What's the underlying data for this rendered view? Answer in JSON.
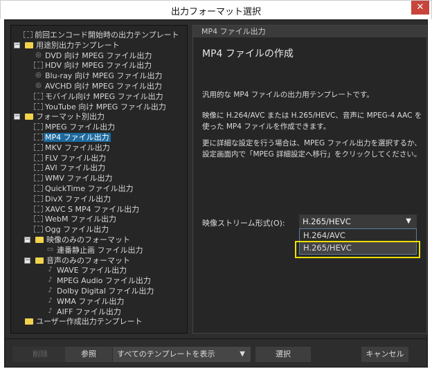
{
  "window": {
    "title": "出力フォーマット選択",
    "close": "✕"
  },
  "tree": [
    {
      "label": "前回エンコード開始時の出力テンプレート",
      "level": 0,
      "icon": "film"
    },
    {
      "label": "用途別出力テンプレート",
      "level": 0,
      "icon": "folder",
      "expanded": true
    },
    {
      "label": "DVD 向け MPEG ファイル出力",
      "level": 1,
      "icon": "disc"
    },
    {
      "label": "HDV 向け MPEG ファイル出力",
      "level": 1,
      "icon": "film"
    },
    {
      "label": "Blu-ray 向け MPEG ファイル出力",
      "level": 1,
      "icon": "disc"
    },
    {
      "label": "AVCHD 向け MPEG ファイル出力",
      "level": 1,
      "icon": "disc"
    },
    {
      "label": "モバイル向け MPEG ファイル出力",
      "level": 1,
      "icon": "film"
    },
    {
      "label": "YouTube 向け MPEG ファイル出力",
      "level": 1,
      "icon": "film"
    },
    {
      "label": "フォーマット別出力",
      "level": 0,
      "icon": "folder",
      "expanded": true
    },
    {
      "label": "MPEG ファイル出力",
      "level": 1,
      "icon": "film"
    },
    {
      "label": "MP4 ファイル出力",
      "level": 1,
      "icon": "film",
      "selected": true
    },
    {
      "label": "MKV ファイル出力",
      "level": 1,
      "icon": "film"
    },
    {
      "label": "FLV ファイル出力",
      "level": 1,
      "icon": "film"
    },
    {
      "label": "AVI ファイル出力",
      "level": 1,
      "icon": "film"
    },
    {
      "label": "WMV ファイル出力",
      "level": 1,
      "icon": "film"
    },
    {
      "label": "QuickTime ファイル出力",
      "level": 1,
      "icon": "film"
    },
    {
      "label": "DivX ファイル出力",
      "level": 1,
      "icon": "film"
    },
    {
      "label": "XAVC S MP4 ファイル出力",
      "level": 1,
      "icon": "film"
    },
    {
      "label": "WebM ファイル出力",
      "level": 1,
      "icon": "film"
    },
    {
      "label": "Ogg ファイル出力",
      "level": 1,
      "icon": "film"
    },
    {
      "label": "映像のみのフォーマット",
      "level": 1,
      "icon": "folder",
      "expanded": true
    },
    {
      "label": "連番静止画 ファイル出力",
      "level": 2,
      "icon": "image"
    },
    {
      "label": "音声のみのフォーマット",
      "level": 1,
      "icon": "folder",
      "expanded": true
    },
    {
      "label": "WAVE ファイル出力",
      "level": 2,
      "icon": "note"
    },
    {
      "label": "MPEG Audio ファイル出力",
      "level": 2,
      "icon": "note"
    },
    {
      "label": "Dolby Digital ファイル出力",
      "level": 2,
      "icon": "note"
    },
    {
      "label": "WMA ファイル出力",
      "level": 2,
      "icon": "note"
    },
    {
      "label": "AIFF ファイル出力",
      "level": 2,
      "icon": "note"
    },
    {
      "label": "ユーザー作成出力テンプレート",
      "level": 0,
      "icon": "folder"
    }
  ],
  "detail": {
    "header": "MP4 ファイル出力",
    "title": "MP4 ファイルの作成",
    "p1": "汎用的な MP4 ファイルの出力用テンプレートです。",
    "p2": "映像に H.264/AVC または H.265/HEVC、音声に MPEG-4 AAC を使った MP4 ファイルを作成できます。",
    "p3": "更に詳細な設定を行う場合は、MPEG ファイル出力を選択するか、設定画面内で「MPEG 詳細設定へ移行」をクリックしてください。",
    "field_label": "映像ストリーム形式(O):",
    "selected": "H.265/HEVC",
    "options": [
      "H.264/AVC",
      "H.265/HEVC"
    ]
  },
  "footer": {
    "delete": "削除",
    "browse": "参照",
    "filter": "すべてのテンプレートを表示",
    "select": "選択",
    "cancel": "キャンセル"
  }
}
